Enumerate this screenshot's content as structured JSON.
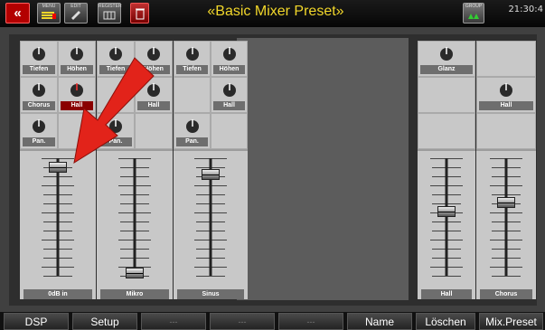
{
  "header": {
    "back_label": "«",
    "menu_label": "MENU",
    "edit_label": "EDIT",
    "register_label": "REGISTER",
    "title": "«Basic Mixer Preset»",
    "clock": "21:30:4",
    "status_label": "GROUP"
  },
  "channels": [
    {
      "name": "0dB in",
      "knobs": [
        {
          "label": "Tiefen",
          "color": "#6e6e6e"
        },
        {
          "label": "Höhen",
          "color": "#6e6e6e"
        },
        {
          "label": "Chorus",
          "color": "#6e6e6e"
        },
        {
          "label": "Hall",
          "color": "#8a0000"
        },
        {
          "label": "Pan.",
          "color": "#6e6e6e"
        }
      ],
      "fader_level": 0.92
    },
    {
      "name": "Mikro",
      "knobs": [
        {
          "label": "Tiefen"
        },
        {
          "label": "Höhen"
        },
        {
          "label": "Hall"
        },
        {
          "label": "Pan."
        }
      ],
      "fader_level": 0.02
    },
    {
      "name": "Sinus",
      "knobs": [
        {
          "label": "Tiefen"
        },
        {
          "label": "Höhen"
        },
        {
          "label": "Hall"
        },
        {
          "label": "Pan."
        }
      ],
      "fader_level": 0.86
    },
    {
      "name": "Hall",
      "knobs": [
        {
          "label": "Glanz"
        }
      ],
      "fader_level": 0.55
    },
    {
      "name": "Chorus",
      "knobs": [
        {
          "label": "Hall"
        }
      ],
      "fader_level": 0.62
    }
  ],
  "function_keys": [
    {
      "label": "DSP",
      "enabled": true
    },
    {
      "label": "Setup",
      "enabled": true
    },
    {
      "label": "---",
      "enabled": false
    },
    {
      "label": "---",
      "enabled": false
    },
    {
      "label": "---",
      "enabled": false
    },
    {
      "label": "Name",
      "enabled": true
    },
    {
      "label": "Löschen",
      "enabled": true
    },
    {
      "label": "Mix.Preset",
      "enabled": true
    }
  ],
  "annotation": {
    "color": "#e2231a"
  }
}
